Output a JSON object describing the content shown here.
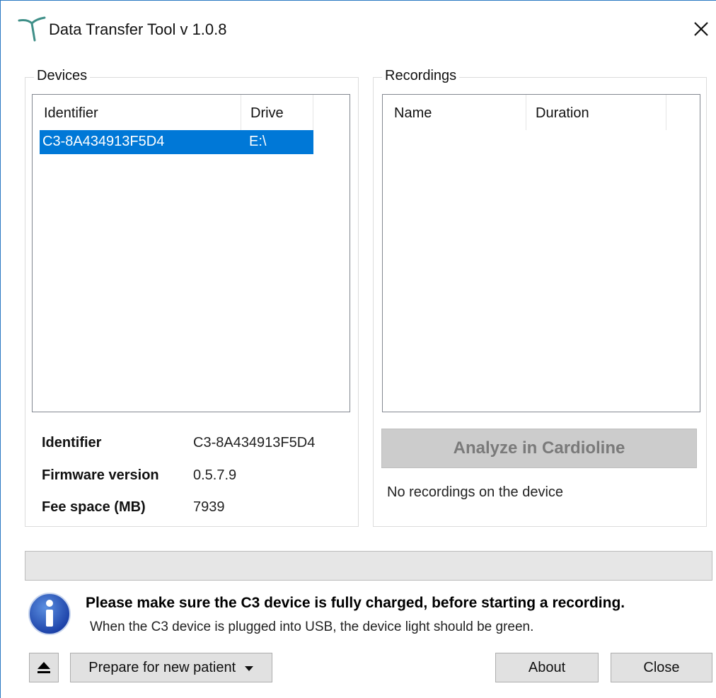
{
  "window": {
    "title": "Data Transfer Tool v 1.0.8",
    "accent_color": "#2b79c2"
  },
  "devices": {
    "group_label": "Devices",
    "columns": [
      "Identifier",
      "Drive"
    ],
    "rows": [
      {
        "identifier": "C3-8A434913F5D4",
        "drive": "E:\\",
        "selected": true
      }
    ],
    "selection_color": "#0078d7"
  },
  "device_info": {
    "identifier_label": "Identifier",
    "identifier_value": "C3-8A434913F5D4",
    "firmware_label": "Firmware version",
    "firmware_value": "0.5.7.9",
    "space_label": "Fee space (MB)",
    "space_value": "7939"
  },
  "recordings": {
    "group_label": "Recordings",
    "columns": [
      "Name",
      "Duration"
    ],
    "rows": [],
    "analyze_label": "Analyze in Cardioline",
    "status_text": "No recordings on the device"
  },
  "progress": {
    "value": 0
  },
  "message": {
    "icon": "info-icon",
    "bold_text": "Please make sure the C3 device is fully charged, before starting a recording.",
    "normal_text": "When the C3 device is plugged into USB, the device light should be green."
  },
  "footer": {
    "eject_icon": "eject-icon",
    "prepare_label": "Prepare for new patient",
    "about_label": "About",
    "close_label": "Close"
  }
}
